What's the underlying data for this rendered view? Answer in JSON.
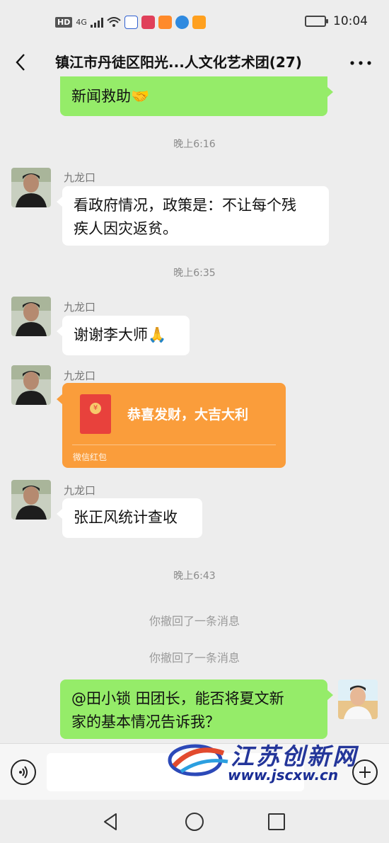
{
  "status_bar": {
    "network": "HD",
    "signal": "4G",
    "time": "10:04"
  },
  "header": {
    "title": "镇江市丹徒区阳光...人文化艺术团(27)"
  },
  "messages": {
    "top_partial": "新闻救助🤝",
    "ts1": "晚上6:16",
    "m1_sender": "九龙口",
    "m1_line1": "看政府情况，政策是：不让每个残",
    "m1_line2": "疾人因灾返贫。",
    "ts2": "晚上6:35",
    "m2_sender": "九龙口",
    "m2_text": "谢谢李大师🙏",
    "m3_sender": "九龙口",
    "red_packet_title": "恭喜发财，大吉大利",
    "red_packet_label": "微信红包",
    "m4_sender": "九龙口",
    "m4_text": "张正风统计查收",
    "ts3": "晚上6:43",
    "recall1": "你撤回了一条消息",
    "recall2": "你撤回了一条消息",
    "m5_line1": "@田小锁  田团长，能否将夏文新",
    "m5_line2": "家的基本情况告诉我？"
  },
  "watermark": {
    "title": "江苏创新网",
    "url": "www.jscxw.cn"
  },
  "colors": {
    "my_bubble": "#95ec69",
    "red_packet": "#fa9d3b",
    "background": "#ededed"
  }
}
